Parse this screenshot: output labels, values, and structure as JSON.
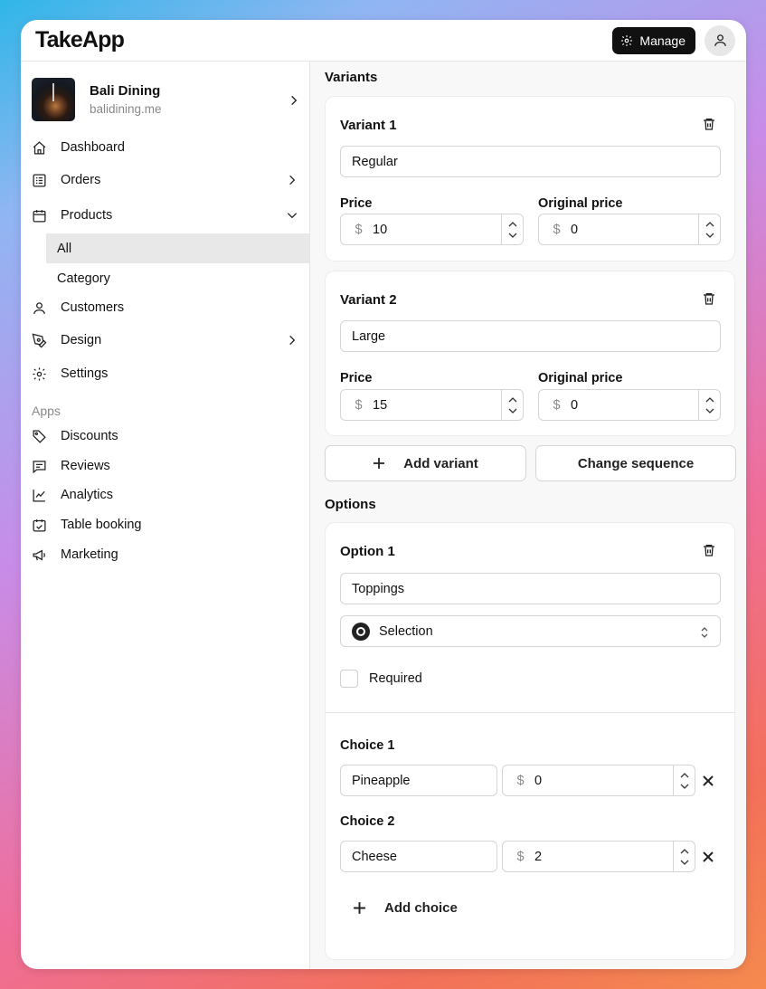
{
  "header": {
    "logo": "TakeApp",
    "manage_label": "Manage"
  },
  "store": {
    "name": "Bali Dining",
    "domain": "balidining.me"
  },
  "nav": {
    "dashboard": "Dashboard",
    "orders": "Orders",
    "products": "Products",
    "products_all": "All",
    "products_category": "Category",
    "customers": "Customers",
    "design": "Design",
    "settings": "Settings",
    "apps_label": "Apps",
    "discounts": "Discounts",
    "reviews": "Reviews",
    "analytics": "Analytics",
    "table_booking": "Table booking",
    "marketing": "Marketing"
  },
  "variants": {
    "section_title": "Variants",
    "items": [
      {
        "title": "Variant 1",
        "name": "Regular",
        "price_label": "Price",
        "price": "10",
        "original_label": "Original price",
        "original": "0",
        "currency": "$"
      },
      {
        "title": "Variant 2",
        "name": "Large",
        "price_label": "Price",
        "price": "15",
        "original_label": "Original price",
        "original": "0",
        "currency": "$"
      }
    ],
    "add_label": "Add variant",
    "sequence_label": "Change sequence"
  },
  "options": {
    "section_title": "Options",
    "option1": {
      "title": "Option 1",
      "name": "Toppings",
      "type": "Selection",
      "required_label": "Required",
      "required": false,
      "choices": [
        {
          "title": "Choice 1",
          "name": "Pineapple",
          "currency": "$",
          "price": "0"
        },
        {
          "title": "Choice 2",
          "name": "Cheese",
          "currency": "$",
          "price": "2"
        }
      ],
      "add_choice_label": "Add choice"
    }
  }
}
